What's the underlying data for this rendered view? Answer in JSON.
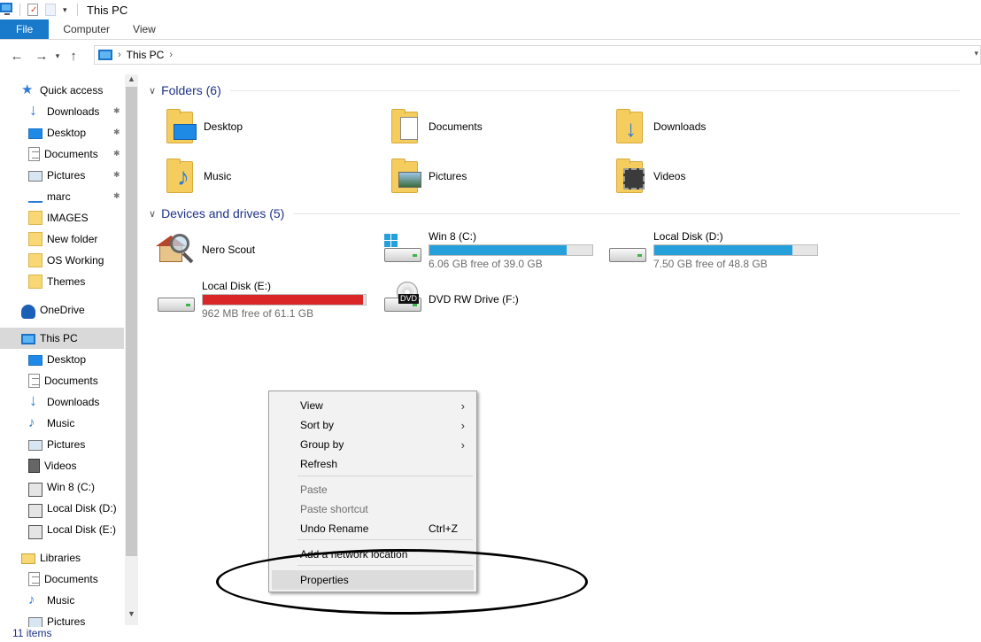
{
  "window": {
    "title": "This PC"
  },
  "ribbon": {
    "tabs": [
      "File",
      "Computer",
      "View"
    ]
  },
  "address": {
    "crumb": "This PC"
  },
  "sidebar": {
    "items": [
      {
        "label": "Quick access",
        "icon": "star-icon"
      },
      {
        "label": "Downloads",
        "icon": "download-icon",
        "pinned": true
      },
      {
        "label": "Desktop",
        "icon": "desktop-icon",
        "pinned": true
      },
      {
        "label": "Documents",
        "icon": "documents-icon",
        "pinned": true
      },
      {
        "label": "Pictures",
        "icon": "pictures-icon",
        "pinned": true
      },
      {
        "label": "marc",
        "icon": "network-icon",
        "pinned": true
      },
      {
        "label": "IMAGES",
        "icon": "folder-icon"
      },
      {
        "label": "New folder",
        "icon": "folder-icon"
      },
      {
        "label": "OS Working",
        "icon": "folder-icon"
      },
      {
        "label": "Themes",
        "icon": "folder-icon"
      },
      {
        "label": "OneDrive",
        "icon": "onedrive-icon"
      },
      {
        "label": "This PC",
        "icon": "computer-icon",
        "selected": true
      },
      {
        "label": "Desktop",
        "icon": "desktop-icon"
      },
      {
        "label": "Documents",
        "icon": "documents-icon"
      },
      {
        "label": "Downloads",
        "icon": "download-icon"
      },
      {
        "label": "Music",
        "icon": "music-icon"
      },
      {
        "label": "Pictures",
        "icon": "pictures-icon"
      },
      {
        "label": "Videos",
        "icon": "videos-icon"
      },
      {
        "label": "Win 8 (C:)",
        "icon": "drive-icon"
      },
      {
        "label": "Local Disk (D:)",
        "icon": "drive-icon"
      },
      {
        "label": "Local Disk (E:)",
        "icon": "drive-icon"
      },
      {
        "label": "Libraries",
        "icon": "libraries-icon"
      },
      {
        "label": "Documents",
        "icon": "documents-icon"
      },
      {
        "label": "Music",
        "icon": "music-icon"
      },
      {
        "label": "Pictures",
        "icon": "pictures-icon"
      }
    ]
  },
  "groups": {
    "folders": {
      "title": "Folders (6)"
    },
    "devices": {
      "title": "Devices and drives (5)"
    }
  },
  "folders": [
    {
      "name": "Desktop",
      "icon": "desktop-folder-icon"
    },
    {
      "name": "Documents",
      "icon": "documents-folder-icon"
    },
    {
      "name": "Downloads",
      "icon": "downloads-folder-icon"
    },
    {
      "name": "Music",
      "icon": "music-folder-icon"
    },
    {
      "name": "Pictures",
      "icon": "pictures-folder-icon"
    },
    {
      "name": "Videos",
      "icon": "videos-folder-icon"
    }
  ],
  "devices": [
    {
      "name": "Nero Scout",
      "icon": "nero-scout-icon"
    },
    {
      "name": "Win 8 (C:)",
      "free": "6.06 GB free of 39.0 GB",
      "used_fraction": 0.845,
      "bar_color": "#26a0da"
    },
    {
      "name": "Local Disk (D:)",
      "free": "7.50 GB free of 48.8 GB",
      "used_fraction": 0.846,
      "bar_color": "#26a0da"
    },
    {
      "name": "Local Disk (E:)",
      "free": "962 MB free of 61.1 GB",
      "used_fraction": 0.985,
      "bar_color": "#da2626"
    },
    {
      "name": "DVD RW Drive (F:)",
      "icon": "dvd-drive-icon",
      "badge": "DVD"
    }
  ],
  "context_menu": {
    "items": [
      {
        "label": "View",
        "submenu": true
      },
      {
        "label": "Sort by",
        "submenu": true
      },
      {
        "label": "Group by",
        "submenu": true
      },
      {
        "label": "Refresh"
      },
      {
        "label": "Paste",
        "disabled": true
      },
      {
        "label": "Paste shortcut",
        "disabled": true
      },
      {
        "label": "Undo Rename",
        "shortcut": "Ctrl+Z"
      },
      {
        "label": "Add a network location"
      },
      {
        "label": "Properties",
        "highlighted": true
      }
    ]
  },
  "status": {
    "count": "11 items"
  },
  "colors": {
    "accent": "#1979ca",
    "bar_normal": "#26a0da",
    "bar_full": "#da2626"
  }
}
